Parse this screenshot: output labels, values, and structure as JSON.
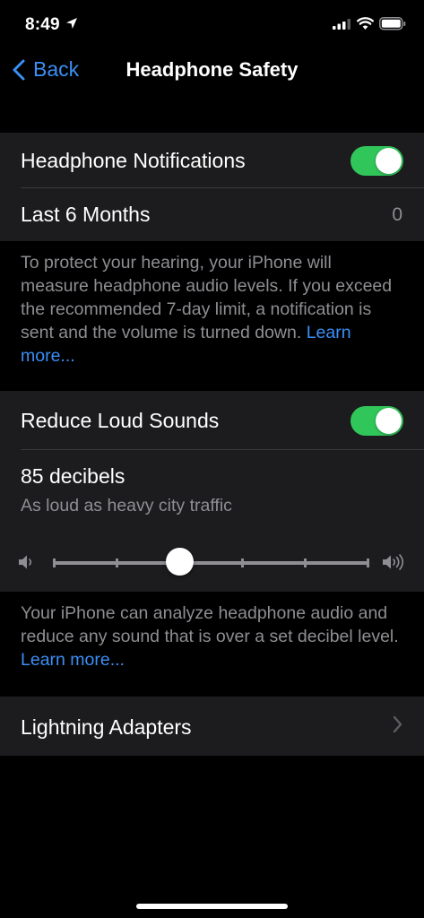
{
  "status_bar": {
    "time": "8:49"
  },
  "nav": {
    "back_label": "Back",
    "title": "Headphone Safety"
  },
  "notifications_group": {
    "headphone_notifications_label": "Headphone Notifications",
    "headphone_notifications_on": true,
    "last_months_label": "Last 6 Months",
    "last_months_value": "0"
  },
  "notifications_footer": {
    "text": "To protect your hearing, your iPhone will measure headphone audio levels. If you exceed the recommended 7-day limit, a notification is sent and the volume is turned down. ",
    "link": "Learn more..."
  },
  "loud_group": {
    "reduce_loud_label": "Reduce Loud Sounds",
    "reduce_loud_on": true,
    "decibel_label": "85 decibels",
    "decibel_description": "As loud as heavy city traffic",
    "slider_steps": 6,
    "slider_selected_index": 2
  },
  "loud_footer": {
    "text": "Your iPhone can analyze headphone audio and reduce any sound that is over a set decibel level. ",
    "link": "Learn more..."
  },
  "adapters_group": {
    "label": "Lightning Adapters"
  },
  "colors": {
    "accent": "#3b8ff6",
    "toggle_on": "#31c65a",
    "cell_bg": "#1c1c1e",
    "secondary_text": "#8e8e93"
  }
}
